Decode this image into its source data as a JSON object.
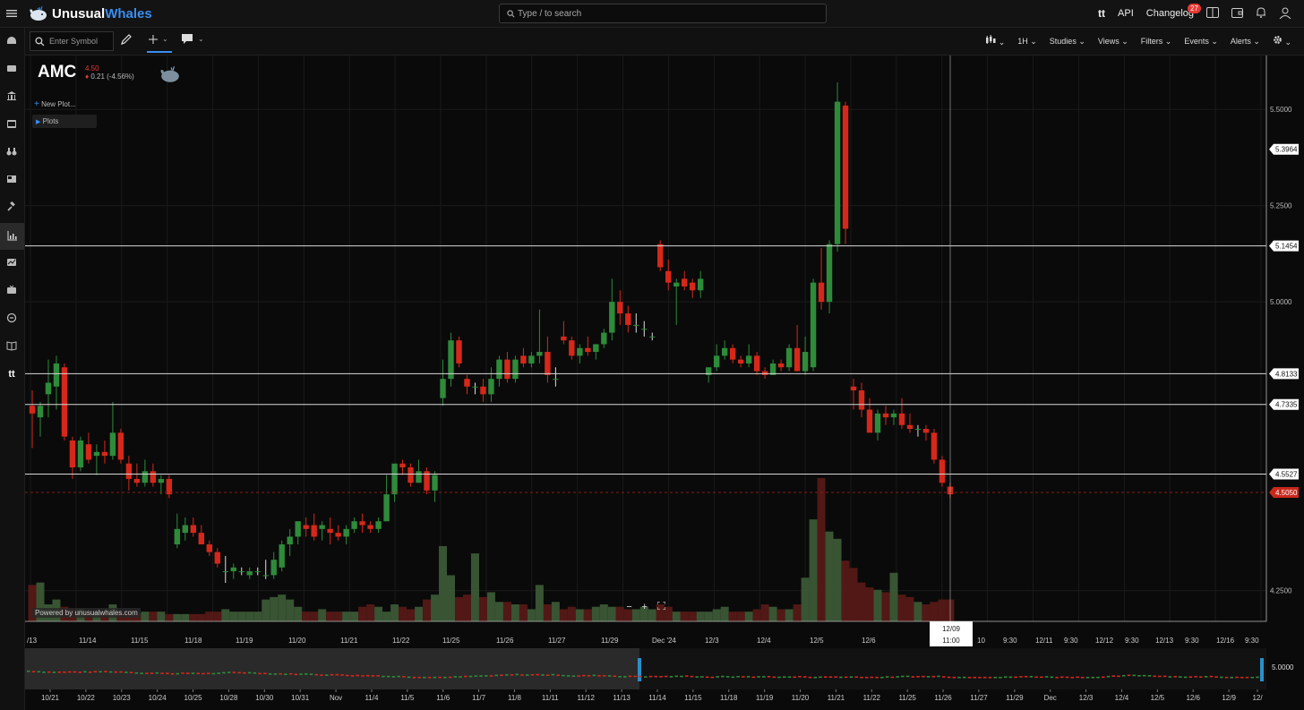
{
  "app": {
    "brand_part1": "Unusual",
    "brand_part2": "Whales"
  },
  "search": {
    "placeholder": "Type / to search"
  },
  "top_right": {
    "tt_label": "tt",
    "api": "API",
    "changelog": "Changelog",
    "changelog_badge": "27"
  },
  "toolbar": {
    "symbol_placeholder": "Enter Symbol",
    "interval": "1H",
    "studies": "Studies",
    "views": "Views",
    "filters": "Filters",
    "events": "Events",
    "alerts": "Alerts"
  },
  "quote": {
    "symbol": "AMC",
    "last": "4.50",
    "change": "0.21 (-4.56%)"
  },
  "panel": {
    "new_plot": "New Plot...",
    "plots": "Plots"
  },
  "powered_by": "Powered by unusualwhales.com",
  "crosshair": {
    "date": "12/09",
    "time": "11:00"
  },
  "chart_data": {
    "type": "candlestick",
    "symbol": "AMC",
    "interval": "1H",
    "ylim": [
      4.17,
      5.64
    ],
    "yticks": [
      "5.5000",
      "5.2500",
      "5.0000",
      "4.2500"
    ],
    "price_lines": [
      {
        "value": "5.3964",
        "style": "label"
      },
      {
        "value": "5.1454",
        "style": "line"
      },
      {
        "value": "4.8133",
        "style": "line"
      },
      {
        "value": "4.7335",
        "style": "line"
      },
      {
        "value": "4.5527",
        "style": "line"
      },
      {
        "value": "4.5050",
        "style": "last"
      }
    ],
    "xticks": [
      "/13",
      "11/14",
      "11/15",
      "11/18",
      "11/19",
      "11/20",
      "11/21",
      "11/22",
      "11/25",
      "11/26",
      "11/27",
      "11/29",
      "Dec '24",
      "12/3",
      "12/4",
      "12/5",
      "12/6",
      "12/9",
      "10",
      "9:30",
      "12/11",
      "9:30",
      "12/12",
      "9:30",
      "12/13",
      "9:30",
      "12/16",
      "9:30"
    ],
    "candles": [
      {
        "o": 4.73,
        "h": 4.77,
        "l": 4.62,
        "c": 4.71
      },
      {
        "o": 4.7,
        "h": 4.74,
        "l": 4.65,
        "c": 4.73
      },
      {
        "o": 4.76,
        "h": 4.85,
        "l": 4.7,
        "c": 4.79
      },
      {
        "o": 4.78,
        "h": 4.86,
        "l": 4.72,
        "c": 4.84
      },
      {
        "o": 4.83,
        "h": 4.84,
        "l": 4.64,
        "c": 4.65
      },
      {
        "o": 4.64,
        "h": 4.65,
        "l": 4.54,
        "c": 4.57
      },
      {
        "o": 4.57,
        "h": 4.65,
        "l": 4.56,
        "c": 4.64
      },
      {
        "o": 4.63,
        "h": 4.66,
        "l": 4.58,
        "c": 4.59
      },
      {
        "o": 4.6,
        "h": 4.63,
        "l": 4.55,
        "c": 4.61
      },
      {
        "o": 4.61,
        "h": 4.64,
        "l": 4.58,
        "c": 4.6
      },
      {
        "o": 4.6,
        "h": 4.74,
        "l": 4.59,
        "c": 4.66
      },
      {
        "o": 4.66,
        "h": 4.67,
        "l": 4.58,
        "c": 4.59
      },
      {
        "o": 4.58,
        "h": 4.6,
        "l": 4.51,
        "c": 4.54
      },
      {
        "o": 4.54,
        "h": 4.58,
        "l": 4.52,
        "c": 4.53
      },
      {
        "o": 4.53,
        "h": 4.59,
        "l": 4.52,
        "c": 4.56
      },
      {
        "o": 4.56,
        "h": 4.58,
        "l": 4.52,
        "c": 4.53
      },
      {
        "o": 4.53,
        "h": 4.55,
        "l": 4.5,
        "c": 4.54
      },
      {
        "o": 4.54,
        "h": 4.55,
        "l": 4.49,
        "c": 4.5
      },
      {
        "o": 4.37,
        "h": 4.45,
        "l": 4.36,
        "c": 4.41
      },
      {
        "o": 4.4,
        "h": 4.44,
        "l": 4.38,
        "c": 4.42
      },
      {
        "o": 4.42,
        "h": 4.44,
        "l": 4.39,
        "c": 4.4
      },
      {
        "o": 4.4,
        "h": 4.42,
        "l": 4.37,
        "c": 4.37
      },
      {
        "o": 4.37,
        "h": 4.38,
        "l": 4.34,
        "c": 4.35
      },
      {
        "o": 4.35,
        "h": 4.36,
        "l": 4.31,
        "c": 4.32
      },
      {
        "o": 4.3,
        "h": 4.34,
        "l": 4.27,
        "c": 4.3
      },
      {
        "o": 4.3,
        "h": 4.32,
        "l": 4.28,
        "c": 4.31
      },
      {
        "o": 4.3,
        "h": 4.31,
        "l": 4.29,
        "c": 4.3
      },
      {
        "o": 4.29,
        "h": 4.31,
        "l": 4.28,
        "c": 4.3
      },
      {
        "o": 4.3,
        "h": 4.31,
        "l": 4.29,
        "c": 4.3
      },
      {
        "o": 4.29,
        "h": 4.33,
        "l": 4.28,
        "c": 4.29
      },
      {
        "o": 4.29,
        "h": 4.35,
        "l": 4.28,
        "c": 4.33
      },
      {
        "o": 4.31,
        "h": 4.38,
        "l": 4.3,
        "c": 4.37
      },
      {
        "o": 4.37,
        "h": 4.41,
        "l": 4.34,
        "c": 4.39
      },
      {
        "o": 4.39,
        "h": 4.43,
        "l": 4.37,
        "c": 4.43
      },
      {
        "o": 4.42,
        "h": 4.44,
        "l": 4.39,
        "c": 4.41
      },
      {
        "o": 4.42,
        "h": 4.45,
        "l": 4.38,
        "c": 4.39
      },
      {
        "o": 4.41,
        "h": 4.43,
        "l": 4.38,
        "c": 4.42
      },
      {
        "o": 4.41,
        "h": 4.44,
        "l": 4.37,
        "c": 4.4
      },
      {
        "o": 4.4,
        "h": 4.42,
        "l": 4.38,
        "c": 4.39
      },
      {
        "o": 4.39,
        "h": 4.42,
        "l": 4.37,
        "c": 4.41
      },
      {
        "o": 4.41,
        "h": 4.44,
        "l": 4.4,
        "c": 4.43
      },
      {
        "o": 4.43,
        "h": 4.45,
        "l": 4.4,
        "c": 4.42
      },
      {
        "o": 4.42,
        "h": 4.43,
        "l": 4.4,
        "c": 4.41
      },
      {
        "o": 4.41,
        "h": 4.44,
        "l": 4.4,
        "c": 4.43
      },
      {
        "o": 4.43,
        "h": 4.55,
        "l": 4.43,
        "c": 4.5
      },
      {
        "o": 4.5,
        "h": 4.54,
        "l": 4.48,
        "c": 4.58
      },
      {
        "o": 4.58,
        "h": 4.59,
        "l": 4.55,
        "c": 4.57
      },
      {
        "o": 4.57,
        "h": 4.58,
        "l": 4.52,
        "c": 4.53
      },
      {
        "o": 4.53,
        "h": 4.59,
        "l": 4.53,
        "c": 4.56
      },
      {
        "o": 4.56,
        "h": 4.57,
        "l": 4.5,
        "c": 4.51
      },
      {
        "o": 4.51,
        "h": 4.56,
        "l": 4.48,
        "c": 4.55
      },
      {
        "o": 4.75,
        "h": 4.85,
        "l": 4.73,
        "c": 4.8
      },
      {
        "o": 4.8,
        "h": 4.92,
        "l": 4.78,
        "c": 4.9
      },
      {
        "o": 4.9,
        "h": 4.91,
        "l": 4.83,
        "c": 4.84
      },
      {
        "o": 4.8,
        "h": 4.81,
        "l": 4.76,
        "c": 4.78
      },
      {
        "o": 4.78,
        "h": 4.79,
        "l": 4.76,
        "c": 4.78
      },
      {
        "o": 4.78,
        "h": 4.8,
        "l": 4.74,
        "c": 4.76
      },
      {
        "o": 4.76,
        "h": 4.83,
        "l": 4.74,
        "c": 4.8
      },
      {
        "o": 4.8,
        "h": 4.86,
        "l": 4.78,
        "c": 4.85
      },
      {
        "o": 4.85,
        "h": 4.87,
        "l": 4.79,
        "c": 4.8
      },
      {
        "o": 4.8,
        "h": 4.86,
        "l": 4.79,
        "c": 4.85
      },
      {
        "o": 4.86,
        "h": 4.88,
        "l": 4.83,
        "c": 4.84
      },
      {
        "o": 4.84,
        "h": 4.87,
        "l": 4.83,
        "c": 4.86
      },
      {
        "o": 4.86,
        "h": 4.98,
        "l": 4.84,
        "c": 4.87
      },
      {
        "o": 4.87,
        "h": 4.91,
        "l": 4.79,
        "c": 4.81
      },
      {
        "o": 4.8,
        "h": 4.83,
        "l": 4.78,
        "c": 4.8
      },
      {
        "o": 4.91,
        "h": 4.95,
        "l": 4.89,
        "c": 4.9
      },
      {
        "o": 4.9,
        "h": 4.91,
        "l": 4.85,
        "c": 4.86
      },
      {
        "o": 4.86,
        "h": 4.89,
        "l": 4.84,
        "c": 4.88
      },
      {
        "o": 4.88,
        "h": 4.91,
        "l": 4.86,
        "c": 4.87
      },
      {
        "o": 4.87,
        "h": 4.89,
        "l": 4.85,
        "c": 4.89
      },
      {
        "o": 4.89,
        "h": 4.93,
        "l": 4.88,
        "c": 4.92
      },
      {
        "o": 4.92,
        "h": 5.06,
        "l": 4.9,
        "c": 5.0
      },
      {
        "o": 5.0,
        "h": 5.03,
        "l": 4.94,
        "c": 4.97
      },
      {
        "o": 4.97,
        "h": 4.99,
        "l": 4.92,
        "c": 4.94
      },
      {
        "o": 4.94,
        "h": 4.97,
        "l": 4.92,
        "c": 4.94
      },
      {
        "o": 4.93,
        "h": 4.95,
        "l": 4.91,
        "c": 4.93
      },
      {
        "o": 4.91,
        "h": 4.92,
        "l": 4.9,
        "c": 4.91
      },
      {
        "o": 5.15,
        "h": 5.16,
        "l": 5.08,
        "c": 5.09
      },
      {
        "o": 5.08,
        "h": 5.11,
        "l": 5.03,
        "c": 5.05
      },
      {
        "o": 5.04,
        "h": 5.06,
        "l": 4.94,
        "c": 5.05
      },
      {
        "o": 5.06,
        "h": 5.08,
        "l": 5.03,
        "c": 5.04
      },
      {
        "o": 5.05,
        "h": 5.06,
        "l": 5.01,
        "c": 5.03
      },
      {
        "o": 5.03,
        "h": 5.08,
        "l": 5.01,
        "c": 5.06
      },
      {
        "o": 4.81,
        "h": 4.83,
        "l": 4.79,
        "c": 4.83
      },
      {
        "o": 4.83,
        "h": 4.89,
        "l": 4.82,
        "c": 4.86
      },
      {
        "o": 4.86,
        "h": 4.9,
        "l": 4.85,
        "c": 4.88
      },
      {
        "o": 4.88,
        "h": 4.89,
        "l": 4.84,
        "c": 4.85
      },
      {
        "o": 4.85,
        "h": 4.86,
        "l": 4.83,
        "c": 4.84
      },
      {
        "o": 4.84,
        "h": 4.89,
        "l": 4.83,
        "c": 4.86
      },
      {
        "o": 4.86,
        "h": 4.87,
        "l": 4.81,
        "c": 4.82
      },
      {
        "o": 4.82,
        "h": 4.83,
        "l": 4.8,
        "c": 4.81
      },
      {
        "o": 4.81,
        "h": 4.85,
        "l": 4.81,
        "c": 4.84
      },
      {
        "o": 4.84,
        "h": 4.85,
        "l": 4.82,
        "c": 4.83
      },
      {
        "o": 4.83,
        "h": 4.89,
        "l": 4.82,
        "c": 4.88
      },
      {
        "o": 4.88,
        "h": 4.94,
        "l": 4.85,
        "c": 4.82
      },
      {
        "o": 4.82,
        "h": 4.91,
        "l": 4.81,
        "c": 4.87
      },
      {
        "o": 4.83,
        "h": 5.06,
        "l": 4.82,
        "c": 5.05
      },
      {
        "o": 5.05,
        "h": 5.14,
        "l": 4.98,
        "c": 5.0
      },
      {
        "o": 5.0,
        "h": 5.16,
        "l": 4.97,
        "c": 5.15
      },
      {
        "o": 5.15,
        "h": 5.57,
        "l": 5.13,
        "c": 5.52
      },
      {
        "o": 5.51,
        "h": 5.52,
        "l": 5.15,
        "c": 5.19
      },
      {
        "o": 4.78,
        "h": 4.8,
        "l": 4.72,
        "c": 4.77
      },
      {
        "o": 4.77,
        "h": 4.79,
        "l": 4.7,
        "c": 4.72
      },
      {
        "o": 4.72,
        "h": 4.75,
        "l": 4.67,
        "c": 4.66
      },
      {
        "o": 4.66,
        "h": 4.72,
        "l": 4.64,
        "c": 4.71
      },
      {
        "o": 4.71,
        "h": 4.73,
        "l": 4.68,
        "c": 4.7
      },
      {
        "o": 4.7,
        "h": 4.72,
        "l": 4.68,
        "c": 4.71
      },
      {
        "o": 4.71,
        "h": 4.75,
        "l": 4.67,
        "c": 4.68
      },
      {
        "o": 4.68,
        "h": 4.71,
        "l": 4.66,
        "c": 4.67
      },
      {
        "o": 4.67,
        "h": 4.68,
        "l": 4.65,
        "c": 4.67
      },
      {
        "o": 4.67,
        "h": 4.68,
        "l": 4.64,
        "c": 4.66
      },
      {
        "o": 4.66,
        "h": 4.67,
        "l": 4.58,
        "c": 4.59
      },
      {
        "o": 4.59,
        "h": 4.6,
        "l": 4.52,
        "c": 4.53
      },
      {
        "o": 4.52,
        "h": 4.53,
        "l": 4.49,
        "c": 4.5
      }
    ],
    "volumes": [
      0.15,
      0.16,
      0.07,
      0.09,
      0.06,
      0.05,
      0.05,
      0.04,
      0.04,
      0.04,
      0.07,
      0.04,
      0.04,
      0.03,
      0.04,
      0.04,
      0.04,
      0.03,
      0.03,
      0.03,
      0.03,
      0.03,
      0.04,
      0.04,
      0.05,
      0.04,
      0.04,
      0.04,
      0.04,
      0.09,
      0.1,
      0.11,
      0.09,
      0.06,
      0.04,
      0.04,
      0.05,
      0.04,
      0.04,
      0.04,
      0.04,
      0.06,
      0.07,
      0.06,
      0.04,
      0.07,
      0.06,
      0.05,
      0.06,
      0.09,
      0.11,
      0.31,
      0.19,
      0.1,
      0.11,
      0.28,
      0.1,
      0.12,
      0.08,
      0.08,
      0.07,
      0.07,
      0.05,
      0.15,
      0.07,
      0.08,
      0.05,
      0.06,
      0.05,
      0.05,
      0.06,
      0.07,
      0.06,
      0.06,
      0.05,
      0.05,
      0.06,
      0.05,
      0.07,
      0.06,
      0.04,
      0.04,
      0.04,
      0.04,
      0.04,
      0.05,
      0.06,
      0.04,
      0.04,
      0.04,
      0.05,
      0.07,
      0.06,
      0.05,
      0.05,
      0.07,
      0.18,
      0.42,
      0.59,
      0.37,
      0.34,
      0.25,
      0.22,
      0.16,
      0.14,
      0.13,
      0.12,
      0.2,
      0.11,
      0.1,
      0.08,
      0.07,
      0.08,
      0.09,
      0.09,
      0.1
    ],
    "navigator_xticks": [
      "10/21",
      "10/22",
      "10/23",
      "10/24",
      "10/25",
      "10/28",
      "10/30",
      "10/31",
      "Nov",
      "11/4",
      "11/5",
      "11/6",
      "11/7",
      "11/8",
      "11/11",
      "11/12",
      "11/13",
      "11/14",
      "11/15",
      "11/18",
      "11/19",
      "11/20",
      "11/21",
      "11/22",
      "11/25",
      "11/26",
      "11/27",
      "11/29",
      "Dec",
      "12/3",
      "12/4",
      "12/5",
      "12/6",
      "12/9",
      "12/"
    ],
    "navigator_yticks": [
      "5.0000"
    ],
    "colors": {
      "up": "#2e8b3a",
      "down": "#d5281a",
      "up_vol": "#3d5c37",
      "down_vol": "#5a1a16"
    }
  }
}
